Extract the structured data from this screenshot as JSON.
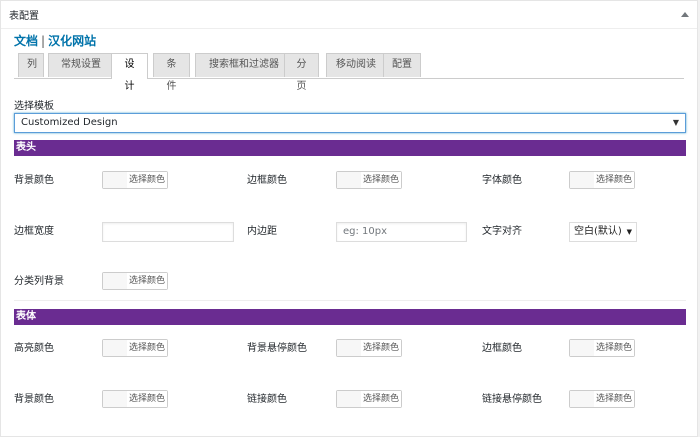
{
  "header": {
    "title": "表配置"
  },
  "links": {
    "docs": "文档",
    "separator": "|",
    "chinese_site": "汉化网站"
  },
  "tabs": [
    "列",
    "常规设置",
    "设计",
    "条件",
    "搜索框和过滤器",
    "分页",
    "移动阅读",
    "配置"
  ],
  "active_tab": "设计",
  "template": {
    "label": "选择模板",
    "value": "Customized Design"
  },
  "sections": {
    "header": {
      "title": "表头",
      "bg_color": "背景颜色",
      "border_color": "边框颜色",
      "font_color": "字体颜色",
      "border_width": "边框宽度",
      "padding": "内边距",
      "padding_placeholder": "eg: 10px",
      "text_align": "文字对齐",
      "text_align_value": "空白(默认)",
      "category_bg": "分类列背景"
    },
    "body": {
      "title": "表体",
      "highlight_color": "高亮颜色",
      "bg_hover_color": "背景悬停颜色",
      "border_color": "边框颜色",
      "bg_color": "背景颜色",
      "link_color": "链接颜色",
      "link_hover_color": "链接悬停颜色"
    }
  },
  "choose_color_label": "选择颜色",
  "colors": {
    "section_bar": "#6a2c91",
    "link": "#0073aa"
  },
  "icons": {
    "collapse": "collapse-arrow-icon",
    "dropdown": "dropdown-arrow-icon"
  }
}
